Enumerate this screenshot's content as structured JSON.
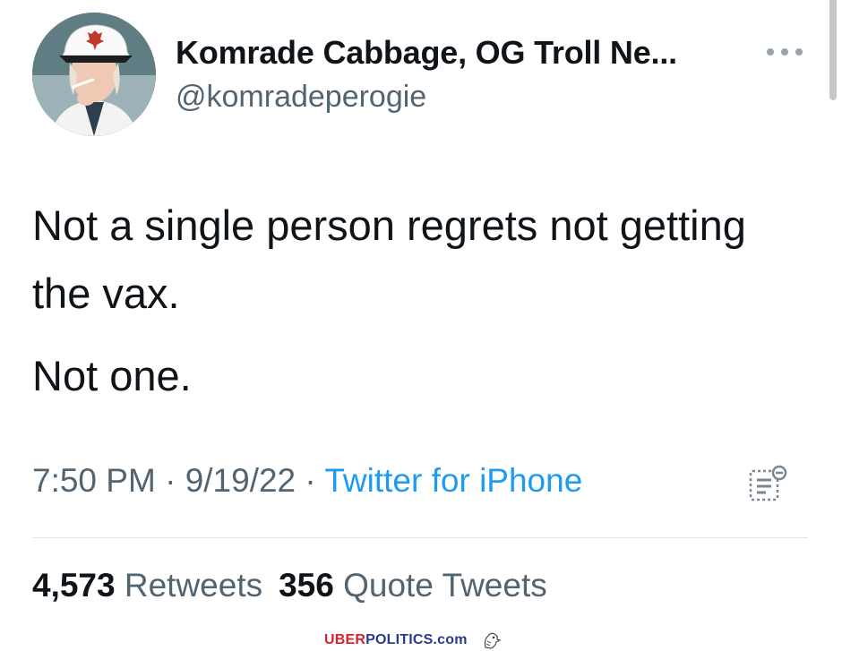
{
  "tweet": {
    "display_name": "Komrade Cabbage, OG Troll Ne...",
    "handle": "@komradeperogie",
    "more_icon": "more-horizontal-icon",
    "text_lines": [
      "Not a single person regrets not getting the vax.",
      "Not one."
    ],
    "time": "7:50 PM",
    "separator": "·",
    "date": "9/19/22",
    "source": "Twitter for iPhone",
    "analytics_icon": "analytics-icon",
    "retweets_count": "4,573",
    "retweets_label": "Retweets",
    "quotes_count": "356",
    "quotes_label": "Quote Tweets"
  },
  "watermark": {
    "part1": "UBER",
    "part2": "POLITICS.com",
    "icon": "eagle-icon"
  },
  "colors": {
    "text": "#0f1419",
    "secondary": "#536471",
    "link": "#1d9bf0",
    "watermark_red": "#d8232a",
    "watermark_blue": "#2a3b8f"
  }
}
